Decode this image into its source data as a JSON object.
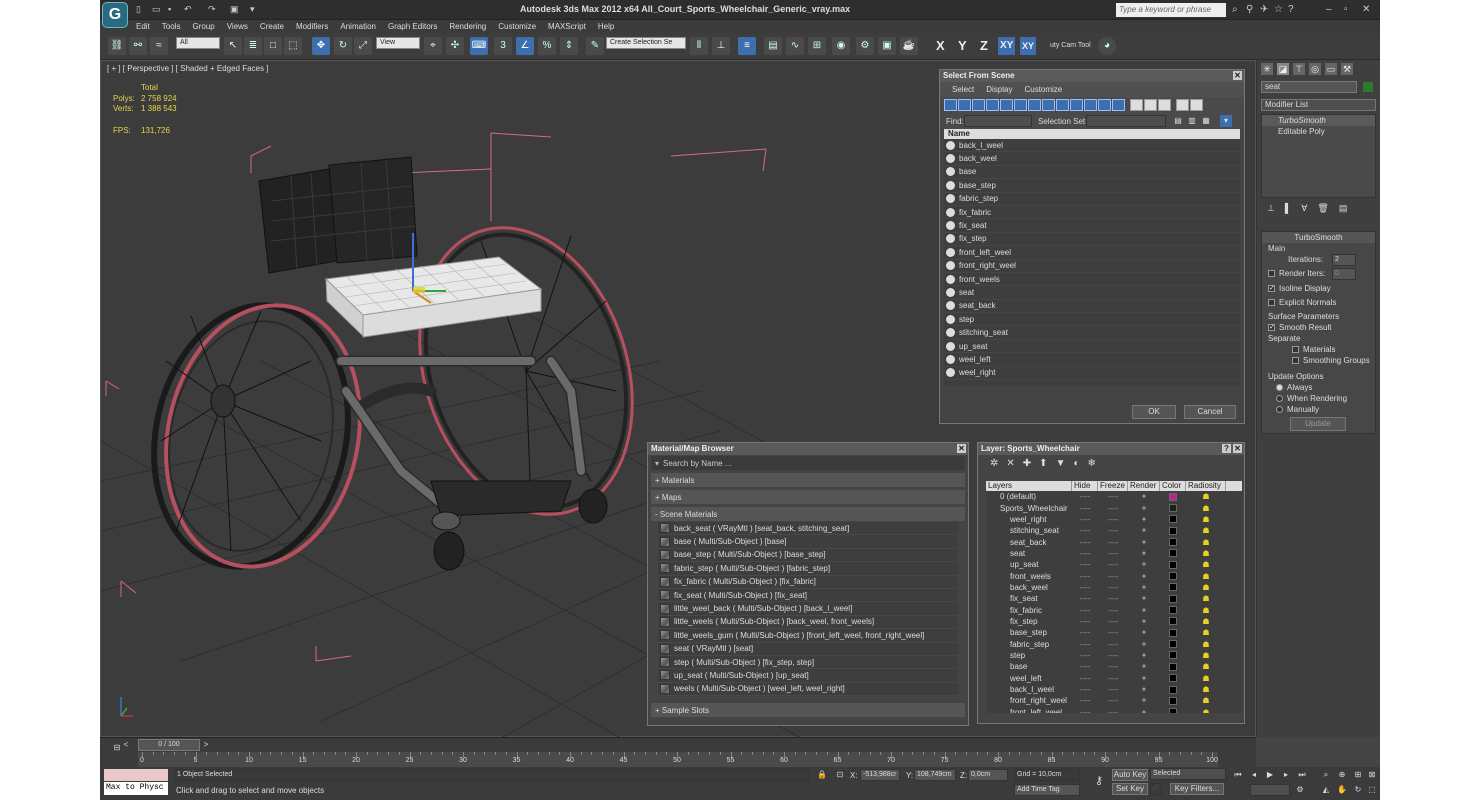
{
  "window": {
    "title": "Autodesk 3ds Max  2012 x64     All_Court_Sports_Wheelchair_Generic_vray.max",
    "search_placeholder": "Type a keyword or phrase"
  },
  "menu": [
    "Edit",
    "Tools",
    "Group",
    "Views",
    "Create",
    "Modifiers",
    "Animation",
    "Graph Editors",
    "Rendering",
    "Customize",
    "MAXScript",
    "Help"
  ],
  "toolbar": {
    "filter_dropdown": "All",
    "coord_dropdown": "View",
    "selection_set_dropdown": "Create Selection Se",
    "cam_tool_label": "uty Cam Tool",
    "axes": [
      "X",
      "Y",
      "Z",
      "XY",
      "XY"
    ]
  },
  "viewport": {
    "label": "[ + ] [ Perspective ] [ Shaded + Edged Faces ]",
    "stats": {
      "total_label": "Total",
      "polys_label": "Polys:",
      "polys": "2 758 924",
      "verts_label": "Verts:",
      "verts": "1 388 543",
      "fps_label": "FPS:",
      "fps": "131,726"
    }
  },
  "select_from_scene": {
    "title": "Select From Scene",
    "menus": [
      "Select",
      "Display",
      "Customize"
    ],
    "find_label": "Find:",
    "selection_set_label": "Selection Set:",
    "column_header": "Name",
    "objects": [
      "back_l_weel",
      "back_weel",
      "base",
      "base_step",
      "fabric_step",
      "fix_fabric",
      "fix_seat",
      "fix_step",
      "front_left_weel",
      "front_right_weel",
      "front_weels",
      "seat",
      "seat_back",
      "step",
      "stitching_seat",
      "up_seat",
      "weel_left",
      "weel_right"
    ],
    "ok": "OK",
    "cancel": "Cancel"
  },
  "material_browser": {
    "title": "Material/Map Browser",
    "search_placeholder": "Search by Name ...",
    "sections": [
      "+ Materials",
      "+ Maps",
      "- Scene Materials"
    ],
    "scene_materials": [
      "back_seat  ( VRayMtl ) [seat_back, stitching_seat]",
      "base  ( Multi/Sub-Object ) [base]",
      "base_step  ( Multi/Sub-Object ) [base_step]",
      "fabric_step  ( Multi/Sub-Object ) [fabric_step]",
      "fix_fabric  ( Multi/Sub-Object ) [fix_fabric]",
      "fix_seat  ( Multi/Sub-Object ) [fix_seat]",
      "little_weel_back  ( Multi/Sub-Object ) [back_l_weel]",
      "little_weels  ( Multi/Sub-Object ) [back_weel, front_weels]",
      "little_weels_gum  ( Multi/Sub-Object ) [front_left_weel, front_right_weel]",
      "seat  ( VRayMtl ) [seat]",
      "step  ( Multi/Sub-Object ) [fix_step, step]",
      "up_seat  ( Multi/Sub-Object ) [up_seat]",
      "weels  ( Multi/Sub-Object ) [weel_left, weel_right]"
    ],
    "footer_section": "+ Sample Slots"
  },
  "layer_manager": {
    "title": "Layer: Sports_Wheelchair",
    "columns": [
      "Layers",
      "Hide",
      "Freeze",
      "Render",
      "Color",
      "Radiosity"
    ],
    "layers": [
      {
        "name": "0 (default)",
        "color": "#c02090",
        "indent": 1
      },
      {
        "name": "Sports_Wheelchair",
        "color": "#202020",
        "indent": 1
      },
      {
        "name": "weel_right",
        "color": "#000000",
        "indent": 2
      },
      {
        "name": "stitching_seat",
        "color": "#000000",
        "indent": 2
      },
      {
        "name": "seat_back",
        "color": "#000000",
        "indent": 2
      },
      {
        "name": "seat",
        "color": "#000000",
        "indent": 2
      },
      {
        "name": "up_seat",
        "color": "#000000",
        "indent": 2
      },
      {
        "name": "front_weels",
        "color": "#000000",
        "indent": 2
      },
      {
        "name": "back_weel",
        "color": "#000000",
        "indent": 2
      },
      {
        "name": "fix_seat",
        "color": "#000000",
        "indent": 2
      },
      {
        "name": "fix_fabric",
        "color": "#000000",
        "indent": 2
      },
      {
        "name": "fix_step",
        "color": "#000000",
        "indent": 2
      },
      {
        "name": "base_step",
        "color": "#000000",
        "indent": 2
      },
      {
        "name": "fabric_step",
        "color": "#000000",
        "indent": 2
      },
      {
        "name": "step",
        "color": "#000000",
        "indent": 2
      },
      {
        "name": "base",
        "color": "#000000",
        "indent": 2
      },
      {
        "name": "weel_left",
        "color": "#000000",
        "indent": 2
      },
      {
        "name": "back_l_weel",
        "color": "#000000",
        "indent": 2
      },
      {
        "name": "front_right_weel",
        "color": "#000000",
        "indent": 2
      },
      {
        "name": "front_left_weel",
        "color": "#000000",
        "indent": 2
      }
    ]
  },
  "command_panel": {
    "object_name": "seat",
    "modifier_list": "Modifier List",
    "stack": [
      "TurboSmooth",
      "Editable Poly"
    ],
    "turbosmooth": {
      "title": "TurboSmooth",
      "main": "Main",
      "iterations_label": "Iterations:",
      "iterations": "2",
      "render_iters_label": "Render Iters:",
      "render_iters": "0",
      "isoline": "Isoline Display",
      "explicit_normals": "Explicit Normals",
      "surface_params": "Surface Parameters",
      "smooth_result": "Smooth Result",
      "separate": "Separate",
      "materials": "Materials",
      "smoothing_groups": "Smoothing Groups",
      "update_options": "Update Options",
      "always": "Always",
      "when_rendering": "When Rendering",
      "manually": "Manually",
      "update_button": "Update"
    }
  },
  "timeline": {
    "slider": "0 / 100",
    "ticks": [
      "0",
      "5",
      "10",
      "15",
      "20",
      "25",
      "30",
      "35",
      "40",
      "45",
      "50",
      "55",
      "60",
      "65",
      "70",
      "75",
      "80",
      "85",
      "90",
      "95",
      "100"
    ]
  },
  "statusbar": {
    "script_label": "Max to Physc",
    "selection": "1 Object Selected",
    "prompt": "Click and drag to select and move objects",
    "x_label": "X:",
    "x": "-513,988cr",
    "y_label": "Y:",
    "y": "108,749cm",
    "z_label": "Z:",
    "z": "0,0cm",
    "grid": "Grid = 10,0cm",
    "add_time_tag": "Add Time Tag",
    "auto_key": "Auto Key",
    "set_key": "Set Key",
    "selected_dropdown": "Selected",
    "key_filters": "Key Filters..."
  }
}
